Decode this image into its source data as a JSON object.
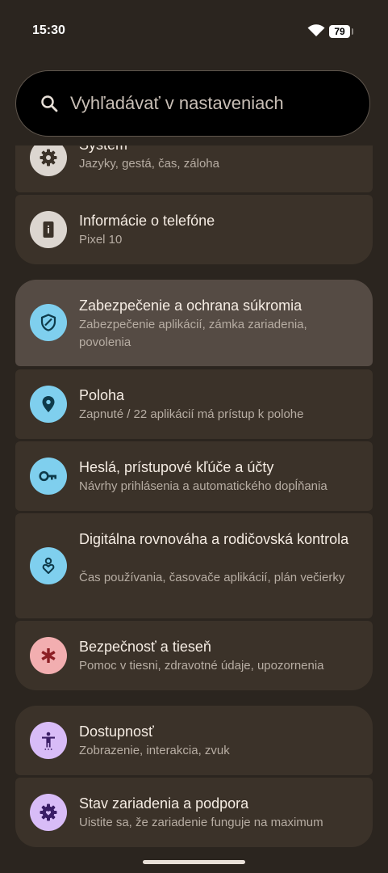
{
  "status": {
    "time": "15:30",
    "battery": "79"
  },
  "search": {
    "placeholder": "Vyhľadávať v nastaveniach"
  },
  "items": [
    {
      "title": "Systém",
      "subtitle": "Jazyky, gestá, čas, záloha",
      "icon": "gear-icon"
    },
    {
      "title": "Informácie o telefóne",
      "subtitle": "Pixel 10",
      "icon": "phone-info-icon"
    },
    {
      "title": "Zabezpečenie a ochrana súkromia",
      "subtitle": "Zabezpečenie aplikácií, zámka zariadenia, povolenia",
      "icon": "shield-icon"
    },
    {
      "title": "Poloha",
      "subtitle": "Zapnuté / 22 aplikácií má prístup k polohe",
      "icon": "location-pin-icon"
    },
    {
      "title": "Heslá, prístupové kľúče a účty",
      "subtitle": "Návrhy prihlásenia a automatického dopĺňania",
      "icon": "key-icon"
    },
    {
      "title": "Digitálna rovnováha a rodičovská kontrola",
      "subtitle": "Čas používania, časovače aplikácií, plán večierky",
      "icon": "wellbeing-icon"
    },
    {
      "title": "Bezpečnosť a tieseň",
      "subtitle": "Pomoc v tiesni, zdravotné údaje, upozornenia",
      "icon": "asterisk-icon"
    },
    {
      "title": "Dostupnosť",
      "subtitle": "Zobrazenie, interakcia, zvuk",
      "icon": "accessibility-icon"
    },
    {
      "title": "Stav zariadenia a podpora",
      "subtitle": "Uistite sa, že zariadenie funguje na maximum",
      "icon": "device-care-icon"
    }
  ],
  "colors": {
    "background": "#2b251f",
    "card": "#3b3229",
    "card_highlight": "#554b44",
    "icon_grey": "#dcd6d0",
    "icon_blue": "#7fcfee",
    "icon_red": "#f2aeb0",
    "icon_purple": "#d8bcf7"
  }
}
